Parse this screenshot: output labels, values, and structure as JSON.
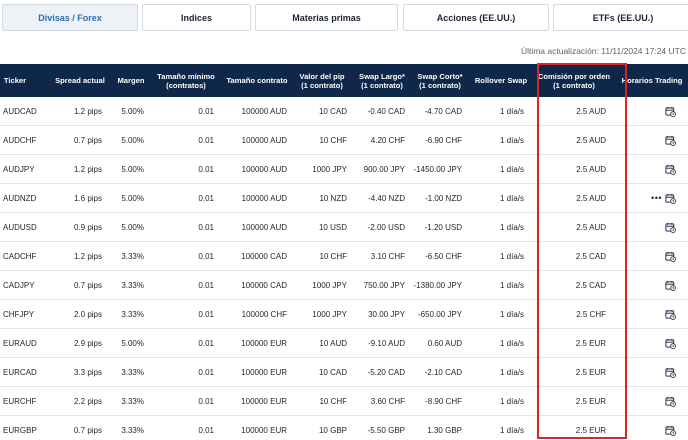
{
  "tabs": [
    "Divisas / Forex",
    "Indices",
    "Materias primas",
    "Acciones (EE.UU.)",
    "ETFs (EE.UU.)"
  ],
  "active_tab": "Divisas / Forex",
  "last_updated": "Última actualización: 11/11/2024 17:24 UTC",
  "columns": [
    {
      "line1": "Ticker",
      "line2": ""
    },
    {
      "line1": "Spread actual",
      "line2": ""
    },
    {
      "line1": "Margen",
      "line2": ""
    },
    {
      "line1": "Tamaño mínimo",
      "line2": "(contratos)"
    },
    {
      "line1": "Tamaño contrato",
      "line2": ""
    },
    {
      "line1": "Valor del pip",
      "line2": "(1 contrato)"
    },
    {
      "line1": "Swap Largo*",
      "line2": "(1 contrato)"
    },
    {
      "line1": "Swap Corto*",
      "line2": "(1 contrato)"
    },
    {
      "line1": "Rollover Swap",
      "line2": ""
    },
    {
      "line1": "Comisión por orden",
      "line2": "(1 contrato)"
    },
    {
      "line1": "Horarios Trading",
      "line2": ""
    }
  ],
  "rows": [
    {
      "ticker": "AUDCAD",
      "spread": "1.2 pips",
      "margin": "5.00%",
      "min_size": "0.01",
      "contract": "100000 AUD",
      "pip": "10 CAD",
      "swap_long": "-0.40 CAD",
      "swap_short": "-4.70 CAD",
      "rollover": "1 día/s",
      "commission": "2.5 AUD",
      "extra": ""
    },
    {
      "ticker": "AUDCHF",
      "spread": "0.7 pips",
      "margin": "5.00%",
      "min_size": "0.01",
      "contract": "100000 AUD",
      "pip": "10 CHF",
      "swap_long": "4.20 CHF",
      "swap_short": "-6.90 CHF",
      "rollover": "1 día/s",
      "commission": "2.5 AUD",
      "extra": ""
    },
    {
      "ticker": "AUDJPY",
      "spread": "1.2 pips",
      "margin": "5.00%",
      "min_size": "0.01",
      "contract": "100000 AUD",
      "pip": "1000 JPY",
      "swap_long": "900.00 JPY",
      "swap_short": "-1450.00 JPY",
      "rollover": "1 día/s",
      "commission": "2.5 AUD",
      "extra": ""
    },
    {
      "ticker": "AUDNZD",
      "spread": "1.6 pips",
      "margin": "5.00%",
      "min_size": "0.01",
      "contract": "100000 AUD",
      "pip": "10 NZD",
      "swap_long": "-4.40 NZD",
      "swap_short": "-1.00 NZD",
      "rollover": "1 día/s",
      "commission": "2.5 AUD",
      "extra": "•••"
    },
    {
      "ticker": "AUDUSD",
      "spread": "0.9 pips",
      "margin": "5.00%",
      "min_size": "0.01",
      "contract": "100000 AUD",
      "pip": "10 USD",
      "swap_long": "-2.00 USD",
      "swap_short": "-1.20 USD",
      "rollover": "1 día/s",
      "commission": "2.5 AUD",
      "extra": ""
    },
    {
      "ticker": "CADCHF",
      "spread": "1.2 pips",
      "margin": "3.33%",
      "min_size": "0.01",
      "contract": "100000 CAD",
      "pip": "10 CHF",
      "swap_long": "3.10 CHF",
      "swap_short": "-6.50 CHF",
      "rollover": "1 día/s",
      "commission": "2.5 CAD",
      "extra": ""
    },
    {
      "ticker": "CADJPY",
      "spread": "0.7 pips",
      "margin": "3.33%",
      "min_size": "0.01",
      "contract": "100000 CAD",
      "pip": "1000 JPY",
      "swap_long": "750.00 JPY",
      "swap_short": "-1380.00 JPY",
      "rollover": "1 día/s",
      "commission": "2.5 CAD",
      "extra": ""
    },
    {
      "ticker": "CHFJPY",
      "spread": "2.0 pips",
      "margin": "3.33%",
      "min_size": "0.01",
      "contract": "100000 CHF",
      "pip": "1000 JPY",
      "swap_long": "30.00 JPY",
      "swap_short": "-650.00 JPY",
      "rollover": "1 día/s",
      "commission": "2.5 CHF",
      "extra": ""
    },
    {
      "ticker": "EURAUD",
      "spread": "2.9 pips",
      "margin": "5.00%",
      "min_size": "0.01",
      "contract": "100000 EUR",
      "pip": "10 AUD",
      "swap_long": "-9.10 AUD",
      "swap_short": "0.60 AUD",
      "rollover": "1 día/s",
      "commission": "2.5 EUR",
      "extra": ""
    },
    {
      "ticker": "EURCAD",
      "spread": "3.3 pips",
      "margin": "3.33%",
      "min_size": "0.01",
      "contract": "100000 EUR",
      "pip": "10 CAD",
      "swap_long": "-5.20 CAD",
      "swap_short": "-2.10 CAD",
      "rollover": "1 día/s",
      "commission": "2.5 EUR",
      "extra": ""
    },
    {
      "ticker": "EURCHF",
      "spread": "2.2 pips",
      "margin": "3.33%",
      "min_size": "0.01",
      "contract": "100000 EUR",
      "pip": "10 CHF",
      "swap_long": "3.60 CHF",
      "swap_short": "-8.90 CHF",
      "rollover": "1 día/s",
      "commission": "2.5 EUR",
      "extra": ""
    },
    {
      "ticker": "EURGBP",
      "spread": "0.7 pips",
      "margin": "3.33%",
      "min_size": "0.01",
      "contract": "100000 EUR",
      "pip": "10 GBP",
      "swap_long": "-5.50 GBP",
      "swap_short": "1.30 GBP",
      "rollover": "1 día/s",
      "commission": "2.5 EUR",
      "extra": ""
    }
  ],
  "icons": {
    "schedule": "calendar-clock-icon"
  },
  "colors": {
    "header_bg": "#0f2748",
    "active_tab_text": "#2b6fb5",
    "highlight": "#e02424"
  }
}
